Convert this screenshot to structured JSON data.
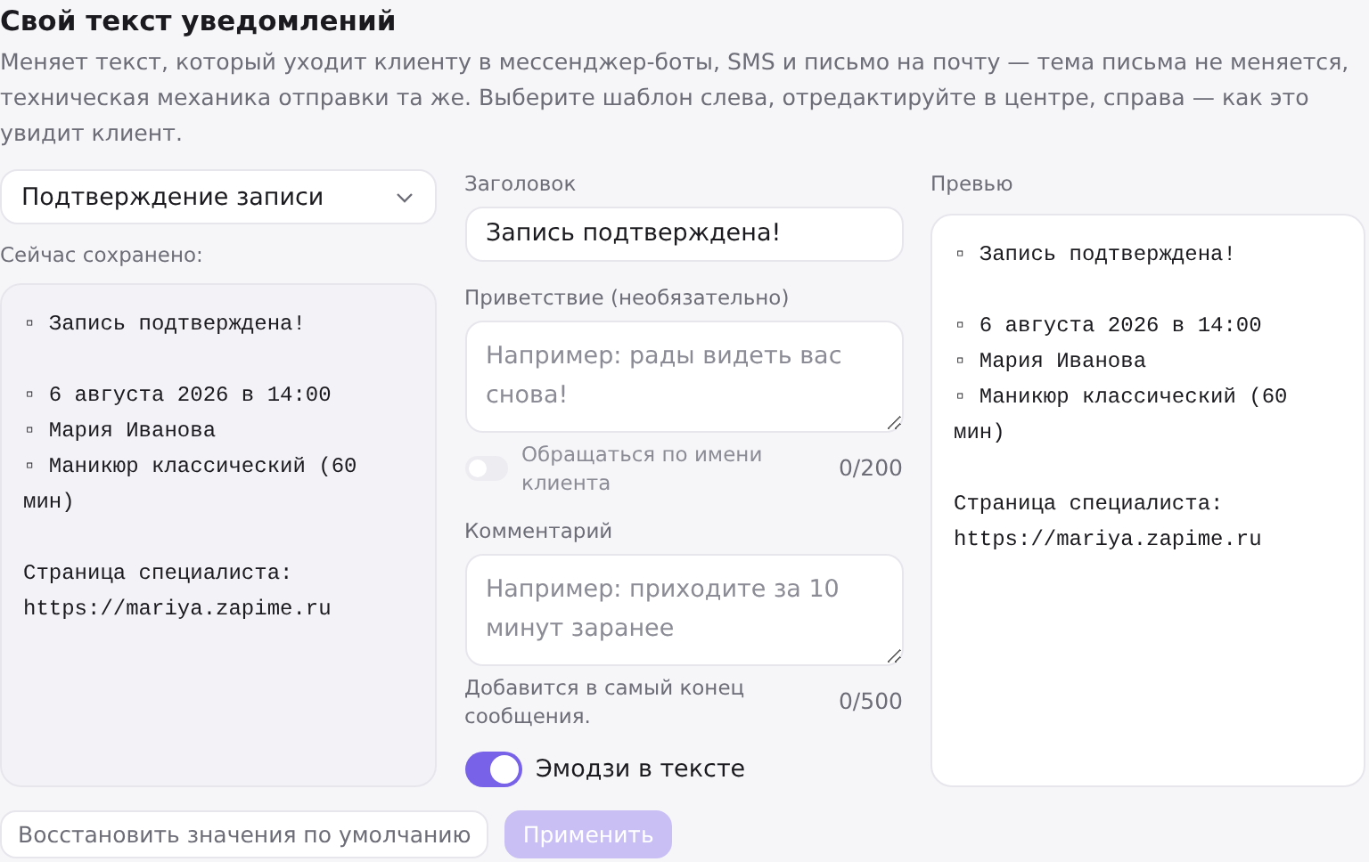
{
  "title": "Свой текст уведомлений",
  "description": "Меняет текст, который уходит клиенту в мессенджер-боты, SMS и письмо на почту — тема письма не меняется, техническая механика отправки та же. Выберите шаблон слева, отредактируйте в центре, справа — как это увидит клиент.",
  "template_select": {
    "value": "Подтверждение записи"
  },
  "saved": {
    "label": "Сейчас сохранено:",
    "message": [
      [
        "▫ Запись подтверждена!"
      ],
      [
        "▫ 6 августа 2026 в 14:00",
        "▫ Мария Иванова",
        "▫ Маникюр классический (60 мин)"
      ],
      [
        "Страница специалиста:",
        "https://mariya.zapime.ru"
      ]
    ]
  },
  "editor": {
    "heading": {
      "label": "Заголовок",
      "value": "Запись подтверждена!"
    },
    "greeting": {
      "label": "Приветствие (необязательно)",
      "placeholder": "Например: рады видеть вас снова!",
      "toggle": {
        "label": "Обращаться по имени клиента",
        "on": false
      },
      "counter": "0/200"
    },
    "comment": {
      "label": "Комментарий",
      "placeholder": "Например: приходите за 10 минут заранее",
      "hint": "Добавится в самый конец сообщения.",
      "counter": "0/500"
    },
    "emoji": {
      "label": "Эмодзи в тексте",
      "on": true
    }
  },
  "preview": {
    "label": "Превью",
    "message": [
      [
        "▫ Запись подтверждена!"
      ],
      [
        "▫ 6 августа 2026 в 14:00",
        "▫ Мария Иванова",
        "▫ Маникюр классический (60 мин)"
      ],
      [
        "Страница специалиста:",
        "https://mariya.zapime.ru"
      ]
    ]
  },
  "buttons": [
    {
      "kind": "secondary",
      "label": "Восстановить значения по умолчанию",
      "disabled": false
    },
    {
      "kind": "primary",
      "label": "Применить",
      "disabled": true
    }
  ]
}
